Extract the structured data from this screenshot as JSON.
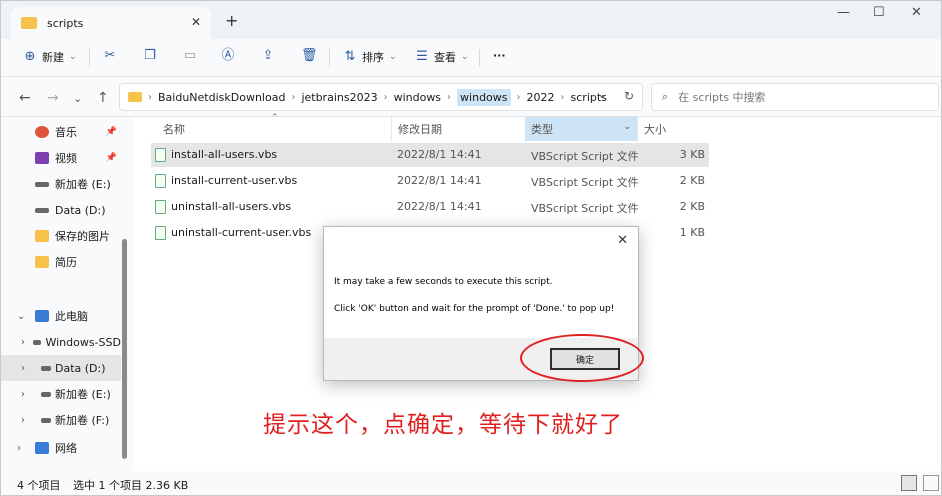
{
  "tab": {
    "title": "scripts",
    "close": "✕",
    "new_tab": "+"
  },
  "window_controls": {
    "minimize": "—",
    "maximize": "☐",
    "close": "✕"
  },
  "toolbar": {
    "new_label": "新建",
    "sort_label": "排序",
    "view_label": "查看",
    "more_label": "···"
  },
  "breadcrumb": [
    "BaiduNetdiskDownload",
    "jetbrains2023",
    "windows",
    "windows",
    "2022",
    "scripts"
  ],
  "search": {
    "placeholder": "在 scripts 中搜索"
  },
  "sidebar": {
    "quick_access": [
      {
        "label": "音乐",
        "color": "#e0543a",
        "pinned": true
      },
      {
        "label": "视频",
        "color": "#7c3fb0",
        "pinned": true
      },
      {
        "label": "新加卷 (E:)",
        "color": "#555555",
        "pinned": false
      },
      {
        "label": "Data (D:)",
        "color": "#555555",
        "pinned": false
      },
      {
        "label": "保存的图片",
        "color": "#f6c24a",
        "pinned": false
      },
      {
        "label": "简历",
        "color": "#f6c24a",
        "pinned": false
      }
    ],
    "this_pc": "此电脑",
    "drives": [
      "Windows-SSD",
      "Data (D:)",
      "新加卷 (E:)",
      "新加卷 (F:)"
    ],
    "network": "网络"
  },
  "columns": {
    "name": "名称",
    "date": "修改日期",
    "type": "类型",
    "size": "大小"
  },
  "files": [
    {
      "name": "install-all-users.vbs",
      "date": "2022/8/1 14:41",
      "type": "VBScript Script 文件",
      "size": "3 KB"
    },
    {
      "name": "install-current-user.vbs",
      "date": "2022/8/1 14:41",
      "type": "VBScript Script 文件",
      "size": "2 KB"
    },
    {
      "name": "uninstall-all-users.vbs",
      "date": "2022/8/1 14:41",
      "type": "VBScript Script 文件",
      "size": "2 KB"
    },
    {
      "name": "uninstall-current-user.vbs",
      "date": "",
      "type": "",
      "size": "1 KB"
    }
  ],
  "status": {
    "count": "4 个项目",
    "selected": "选中 1 个项目  2.36 KB"
  },
  "dialog": {
    "message1": "It may take a few seconds to execute this script.",
    "message2": "Click 'OK' button and wait for the prompt of 'Done.' to pop up!",
    "ok_label": "确定",
    "close": "✕"
  },
  "annotation": "提示这个，点确定，等待下就好了",
  "colors": {
    "accent": "#cde4f7",
    "annotation_red": "#e02020",
    "folder": "#f6c24a"
  }
}
